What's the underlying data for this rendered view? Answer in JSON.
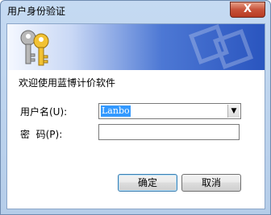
{
  "window": {
    "title": "用户身份验证",
    "close_label": "X"
  },
  "banner": {
    "icon": "keys-icon"
  },
  "welcome_text": "欢迎使用蓝博计价软件",
  "form": {
    "username_label": "用户名(U):",
    "username_value": "Lanbo",
    "password_label": "密  码(P):",
    "password_value": ""
  },
  "buttons": {
    "ok": "确定",
    "cancel": "取消"
  }
}
